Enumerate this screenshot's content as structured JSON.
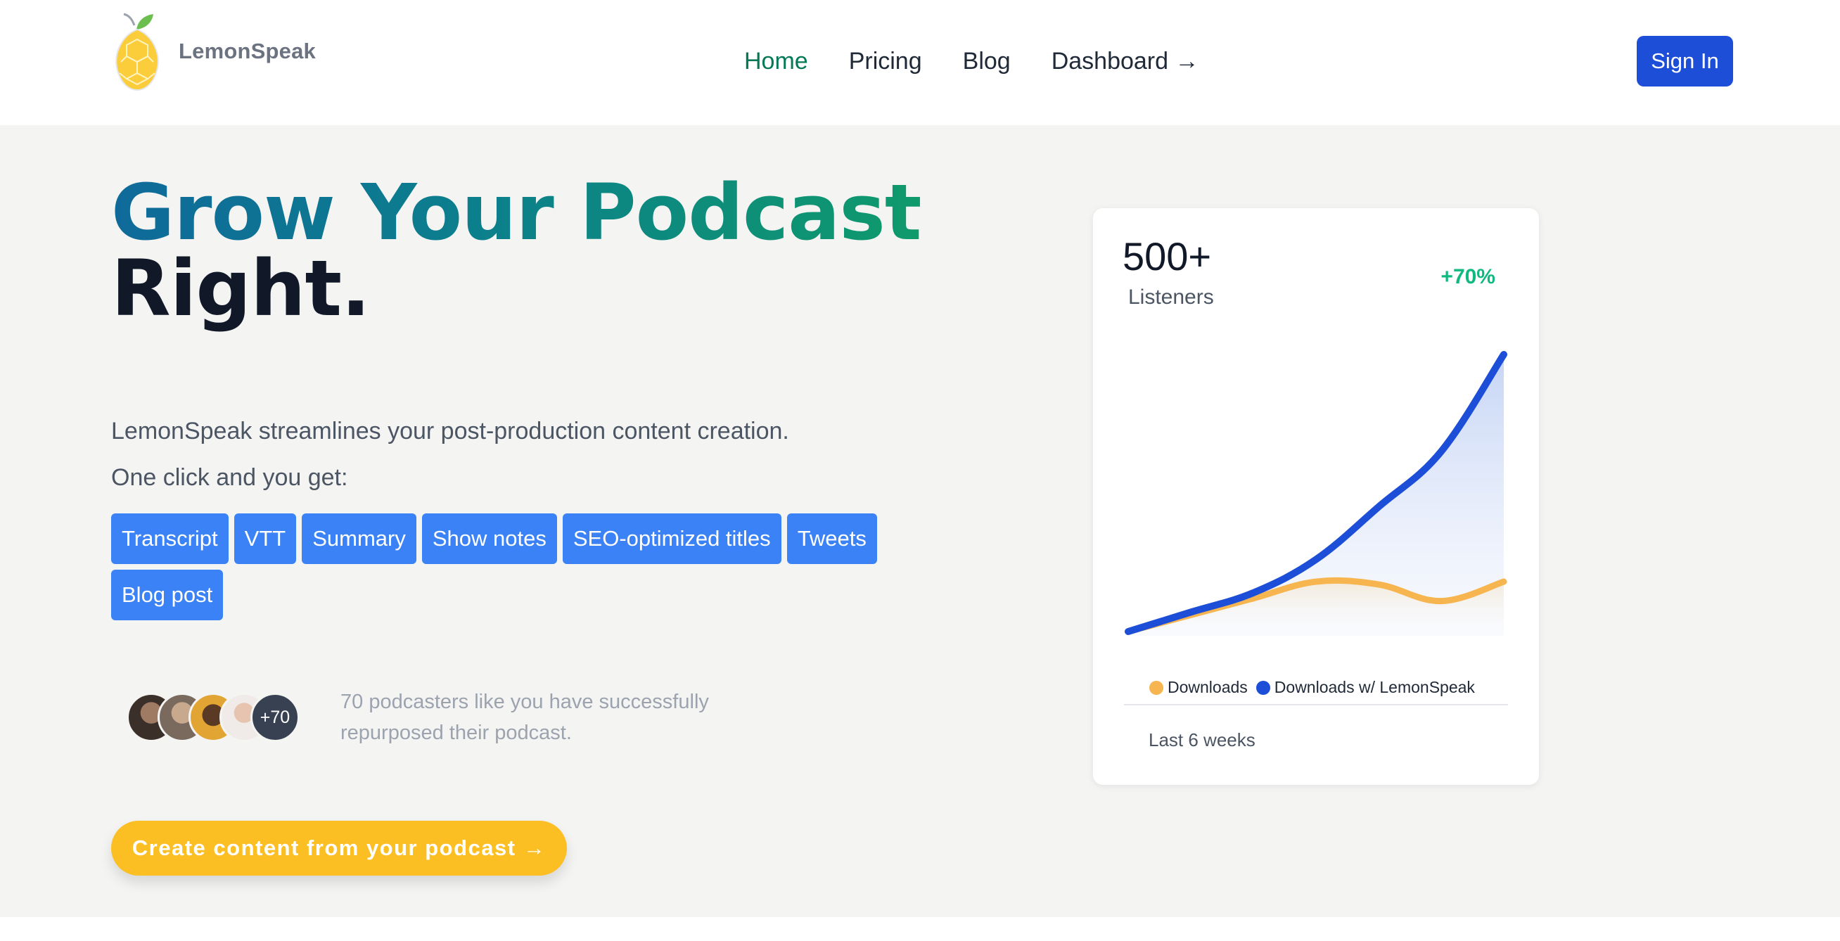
{
  "header": {
    "brand": "LemonSpeak",
    "nav": [
      {
        "label": "Home",
        "active": true
      },
      {
        "label": "Pricing",
        "active": false
      },
      {
        "label": "Blog",
        "active": false
      },
      {
        "label": "Dashboard →",
        "active": false
      }
    ],
    "signin": "Sign In"
  },
  "hero": {
    "headline_gradient": "Grow Your Podcast",
    "headline_dark": "Right.",
    "lead_line1": "LemonSpeak streamlines your post-production content creation.",
    "lead_line2": "One click and you get:",
    "chips": [
      "Transcript",
      "VTT",
      "Summary",
      "Show notes",
      "SEO-optimized titles",
      "Tweets",
      "Blog post"
    ],
    "avatar_more": "+70",
    "social_proof": "70 podcasters like you have successfully repurposed their podcast.",
    "cta": "Create content from your podcast →"
  },
  "card": {
    "metric": "500+",
    "metric_label": "Listeners",
    "growth": "+70%",
    "period": "Last 6 weeks"
  },
  "chart_data": {
    "type": "area",
    "x": [
      0,
      1,
      2,
      3,
      4,
      5,
      6
    ],
    "series": [
      {
        "name": "Downloads",
        "color": "#f6b54e",
        "values": [
          0,
          6,
          12,
          18,
          17,
          11,
          18
        ]
      },
      {
        "name": "Downloads w/ LemonSpeak",
        "color": "#1d4ed8",
        "values": [
          0,
          7,
          14,
          26,
          45,
          65,
          100
        ]
      }
    ],
    "ylim": [
      0,
      100
    ],
    "legend_position": "bottom",
    "grid": false
  },
  "colors": {
    "accent_green": "#047857",
    "brand_blue": "#1d4ed8",
    "chip_blue": "#3b82f6",
    "cta_yellow": "#fbbf24",
    "growth_green": "#10b981"
  },
  "icons": {
    "logo": "lemon-logo-icon",
    "arrow": "arrow-right-icon"
  }
}
